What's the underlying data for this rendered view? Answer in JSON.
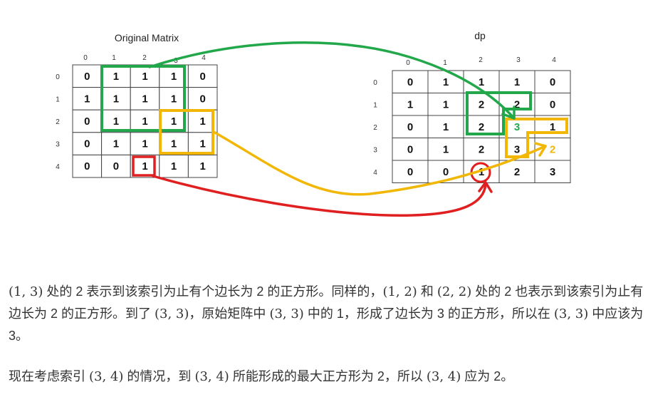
{
  "diagram": {
    "left_title": "Original Matrix",
    "right_title": "dp",
    "col_indices": [
      "0",
      "1",
      "2",
      "3",
      "4"
    ],
    "row_indices": [
      "0",
      "1",
      "2",
      "3",
      "4"
    ],
    "original_matrix": [
      [
        "0",
        "1",
        "1",
        "1",
        "0"
      ],
      [
        "1",
        "1",
        "1",
        "1",
        "0"
      ],
      [
        "0",
        "1",
        "1",
        "1",
        "1"
      ],
      [
        "0",
        "1",
        "1",
        "1",
        "1"
      ],
      [
        "0",
        "0",
        "1",
        "1",
        "1"
      ]
    ],
    "dp_matrix": [
      [
        "0",
        "1",
        "1",
        "1",
        "0"
      ],
      [
        "1",
        "1",
        "2",
        "2",
        "0"
      ],
      [
        "0",
        "1",
        "2",
        "3",
        "1"
      ],
      [
        "0",
        "1",
        "2",
        "3",
        "2"
      ],
      [
        "0",
        "0",
        "1",
        "2",
        "3"
      ]
    ],
    "colors": {
      "green": "#22a84a",
      "yellow": "#f2b705",
      "red": "#e02020",
      "grid": "#444444"
    }
  },
  "text": {
    "p1": [
      {
        "t": "m",
        "v": "(1, 3)"
      },
      {
        "t": "s",
        "v": " 处的 2 表示到该索引为止有个边长为 2 的正方形。同样的，"
      },
      {
        "t": "m",
        "v": "(1, 2)"
      },
      {
        "t": "s",
        "v": " 和 "
      },
      {
        "t": "m",
        "v": "(2, 2)"
      },
      {
        "t": "s",
        "v": " 处的 2 也表示到该索引为止有边长为 2 的正方形。到了 "
      },
      {
        "t": "m",
        "v": "(3, 3)"
      },
      {
        "t": "s",
        "v": "，原始矩阵中 "
      },
      {
        "t": "m",
        "v": "(3, 3)"
      },
      {
        "t": "s",
        "v": " 中的 1，形成了边长为 3 的正方形，所以在 "
      },
      {
        "t": "m",
        "v": "(3, 3)"
      },
      {
        "t": "s",
        "v": " 中应该为 3。"
      }
    ],
    "p2": [
      {
        "t": "s",
        "v": "现在考虑索引 "
      },
      {
        "t": "m",
        "v": "(3, 4)"
      },
      {
        "t": "s",
        "v": " 的情况，到 "
      },
      {
        "t": "m",
        "v": "(3, 4)"
      },
      {
        "t": "s",
        "v": " 所能形成的最大正方形为 2，所以 "
      },
      {
        "t": "m",
        "v": "(3, 4)"
      },
      {
        "t": "s",
        "v": " 应为 2。"
      }
    ]
  }
}
